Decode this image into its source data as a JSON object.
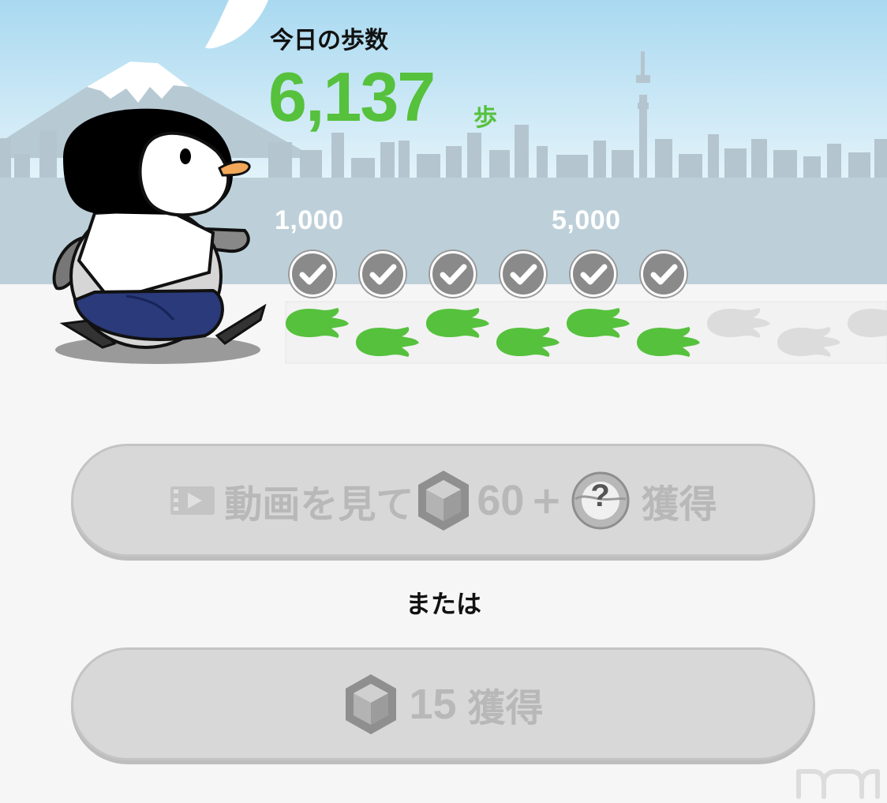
{
  "header": {
    "steps_label": "今日の歩数",
    "steps_count": "6,137",
    "steps_unit": "歩"
  },
  "progress": {
    "milestones": [
      {
        "label": "1,000"
      },
      {
        "label": "5,000"
      }
    ],
    "checks_completed": 6,
    "footprints_total": 9,
    "footprints_filled": 6
  },
  "actions": {
    "video_button": {
      "text_watch": "動画を見て",
      "gem_amount": "60",
      "plus": "+",
      "mystery_symbol": "?",
      "text_get": "獲得"
    },
    "or_label": "または",
    "gem_button": {
      "gem_amount": "15",
      "text_get": "獲得"
    }
  },
  "icons": {
    "video": "video-icon",
    "gem": "gem-icon",
    "mystery": "mystery-ball-icon",
    "check": "check-icon"
  },
  "colors": {
    "accent_green": "#56c13d",
    "sky": "#cfeaf7",
    "button_disabled": "#d8d8d8"
  }
}
